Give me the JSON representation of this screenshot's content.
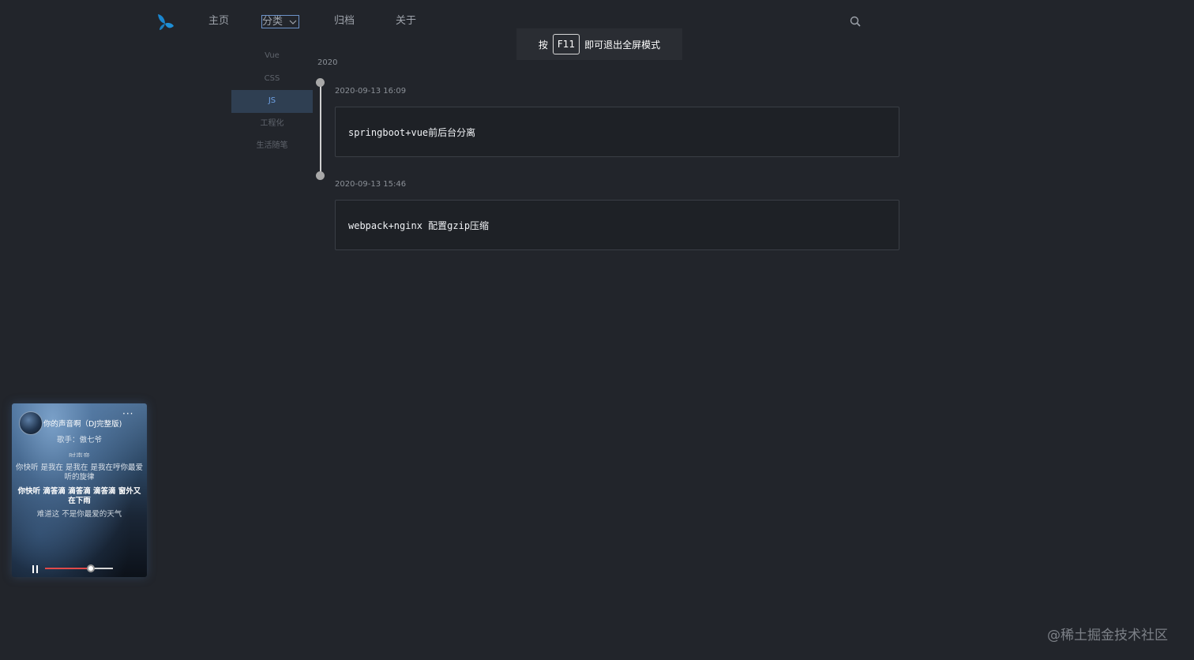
{
  "nav": {
    "home": "主页",
    "category": "分类",
    "archive": "归档",
    "about": "关于"
  },
  "toast": {
    "before": "按",
    "key": "F11",
    "after": "即可退出全屏模式"
  },
  "categories": [
    {
      "label": "Vue",
      "active": false
    },
    {
      "label": "CSS",
      "active": false
    },
    {
      "label": "JS",
      "active": true
    },
    {
      "label": "工程化",
      "active": false
    },
    {
      "label": "生活随笔",
      "active": false
    }
  ],
  "timeline": {
    "year": "2020",
    "posts": [
      {
        "date": "2020-09-13 16:09",
        "title": "springboot+vue前后台分离"
      },
      {
        "date": "2020-09-13 15:46",
        "title": "webpack+nginx 配置gzip压缩"
      }
    ]
  },
  "player": {
    "song": "你的声音啊（DJ完整版)",
    "singer": "歌手：傲七爷",
    "lyric_cut": "时声音",
    "lyrics": [
      "你快听  是我在  是我在  是我在哼你最爱听的旋律",
      "你快听  滴答滴  滴答滴  滴答滴  窗外又在下雨",
      "难道这  不是你最爱的天气"
    ],
    "progress": 0.68,
    "colors": {
      "progress": "#e04a4a",
      "track": "#d5d5d5"
    }
  },
  "watermark": "@稀土掘金技术社区",
  "icons": {
    "logo": "butterfly-logo-icon",
    "search": "search-icon",
    "dropdown": "chevron-down-icon",
    "more": "more-icon",
    "pause": "pause-icon"
  },
  "colors": {
    "background": "#22252b",
    "accent": "#6fa2e6",
    "logo": "#1e8fd6"
  }
}
